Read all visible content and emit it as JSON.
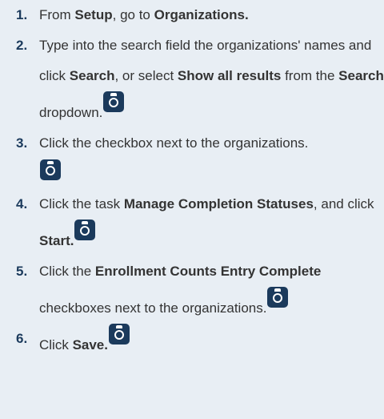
{
  "steps": [
    {
      "number": "1.",
      "t1": "From ",
      "b1": "Setup",
      "t2": ", go to ",
      "b2": "Organizations."
    },
    {
      "number": "2.",
      "t1": "Type into the search field the organizations' names and click ",
      "b1": "Search",
      "t2": ", or select ",
      "b2": "Show all results",
      "t3": " from the ",
      "b3": "Search",
      "t4": " dropdown."
    },
    {
      "number": "3.",
      "t1": "Click the checkbox next to the organizations."
    },
    {
      "number": "4.",
      "t1": "Click the task ",
      "b1": "Manage Completion Statuses",
      "t2": ", and click ",
      "b2": "Start."
    },
    {
      "number": "5.",
      "t1": "Click the ",
      "b1": "Enrollment Counts Entry Complete",
      "t2": " checkboxes next to the organizations."
    },
    {
      "number": "6.",
      "t1": "Click ",
      "b1": "Save."
    }
  ],
  "icons": {
    "camera": "camera-icon",
    "color": "#1b3a5c"
  }
}
